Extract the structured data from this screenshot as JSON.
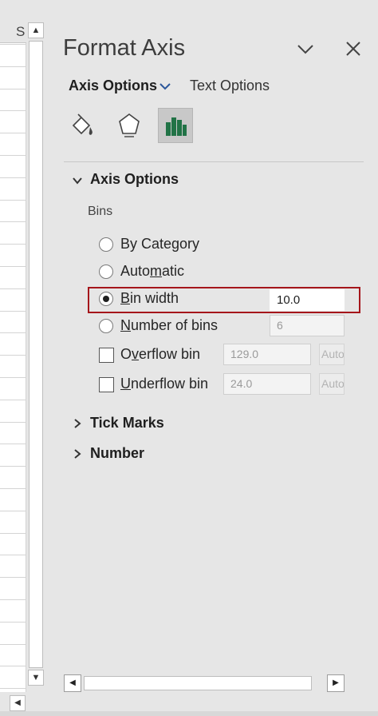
{
  "sheet": {
    "column_header": "S",
    "scroll_up": "▲",
    "scroll_down": "▼",
    "scroll_left": "◀"
  },
  "pane": {
    "title": "Format Axis",
    "tabs": {
      "axis_options": "Axis Options",
      "text_options": "Text Options"
    },
    "icons": [
      "fill-line-icon",
      "effects-icon",
      "axis-options-icon"
    ],
    "sections": {
      "axis_options": "Axis Options",
      "bins_label": "Bins",
      "tick_marks": "Tick Marks",
      "number": "Number"
    },
    "bins": {
      "by_category": "By Category",
      "automatic_pre": "Auto",
      "automatic_ul": "m",
      "automatic_post": "atic",
      "bin_width_ul": "B",
      "bin_width_post": "in width",
      "bin_width_value": "10.0",
      "number_of_bins_ul": "N",
      "number_of_bins_post": "umber of bins",
      "number_of_bins_value": "6",
      "overflow_pre": "O",
      "overflow_ul": "v",
      "overflow_post": "erflow bin",
      "overflow_value": "129.0",
      "overflow_auto": "Auto",
      "underflow_ul": "U",
      "underflow_post": "nderflow bin",
      "underflow_value": "24.0",
      "underflow_auto": "Auto",
      "selected": "bin_width"
    },
    "scroll_left": "◀",
    "scroll_right": "▶"
  },
  "colors": {
    "highlight": "#a5161b",
    "accent_chart": "#217346",
    "chevron_blue": "#2b579a"
  }
}
